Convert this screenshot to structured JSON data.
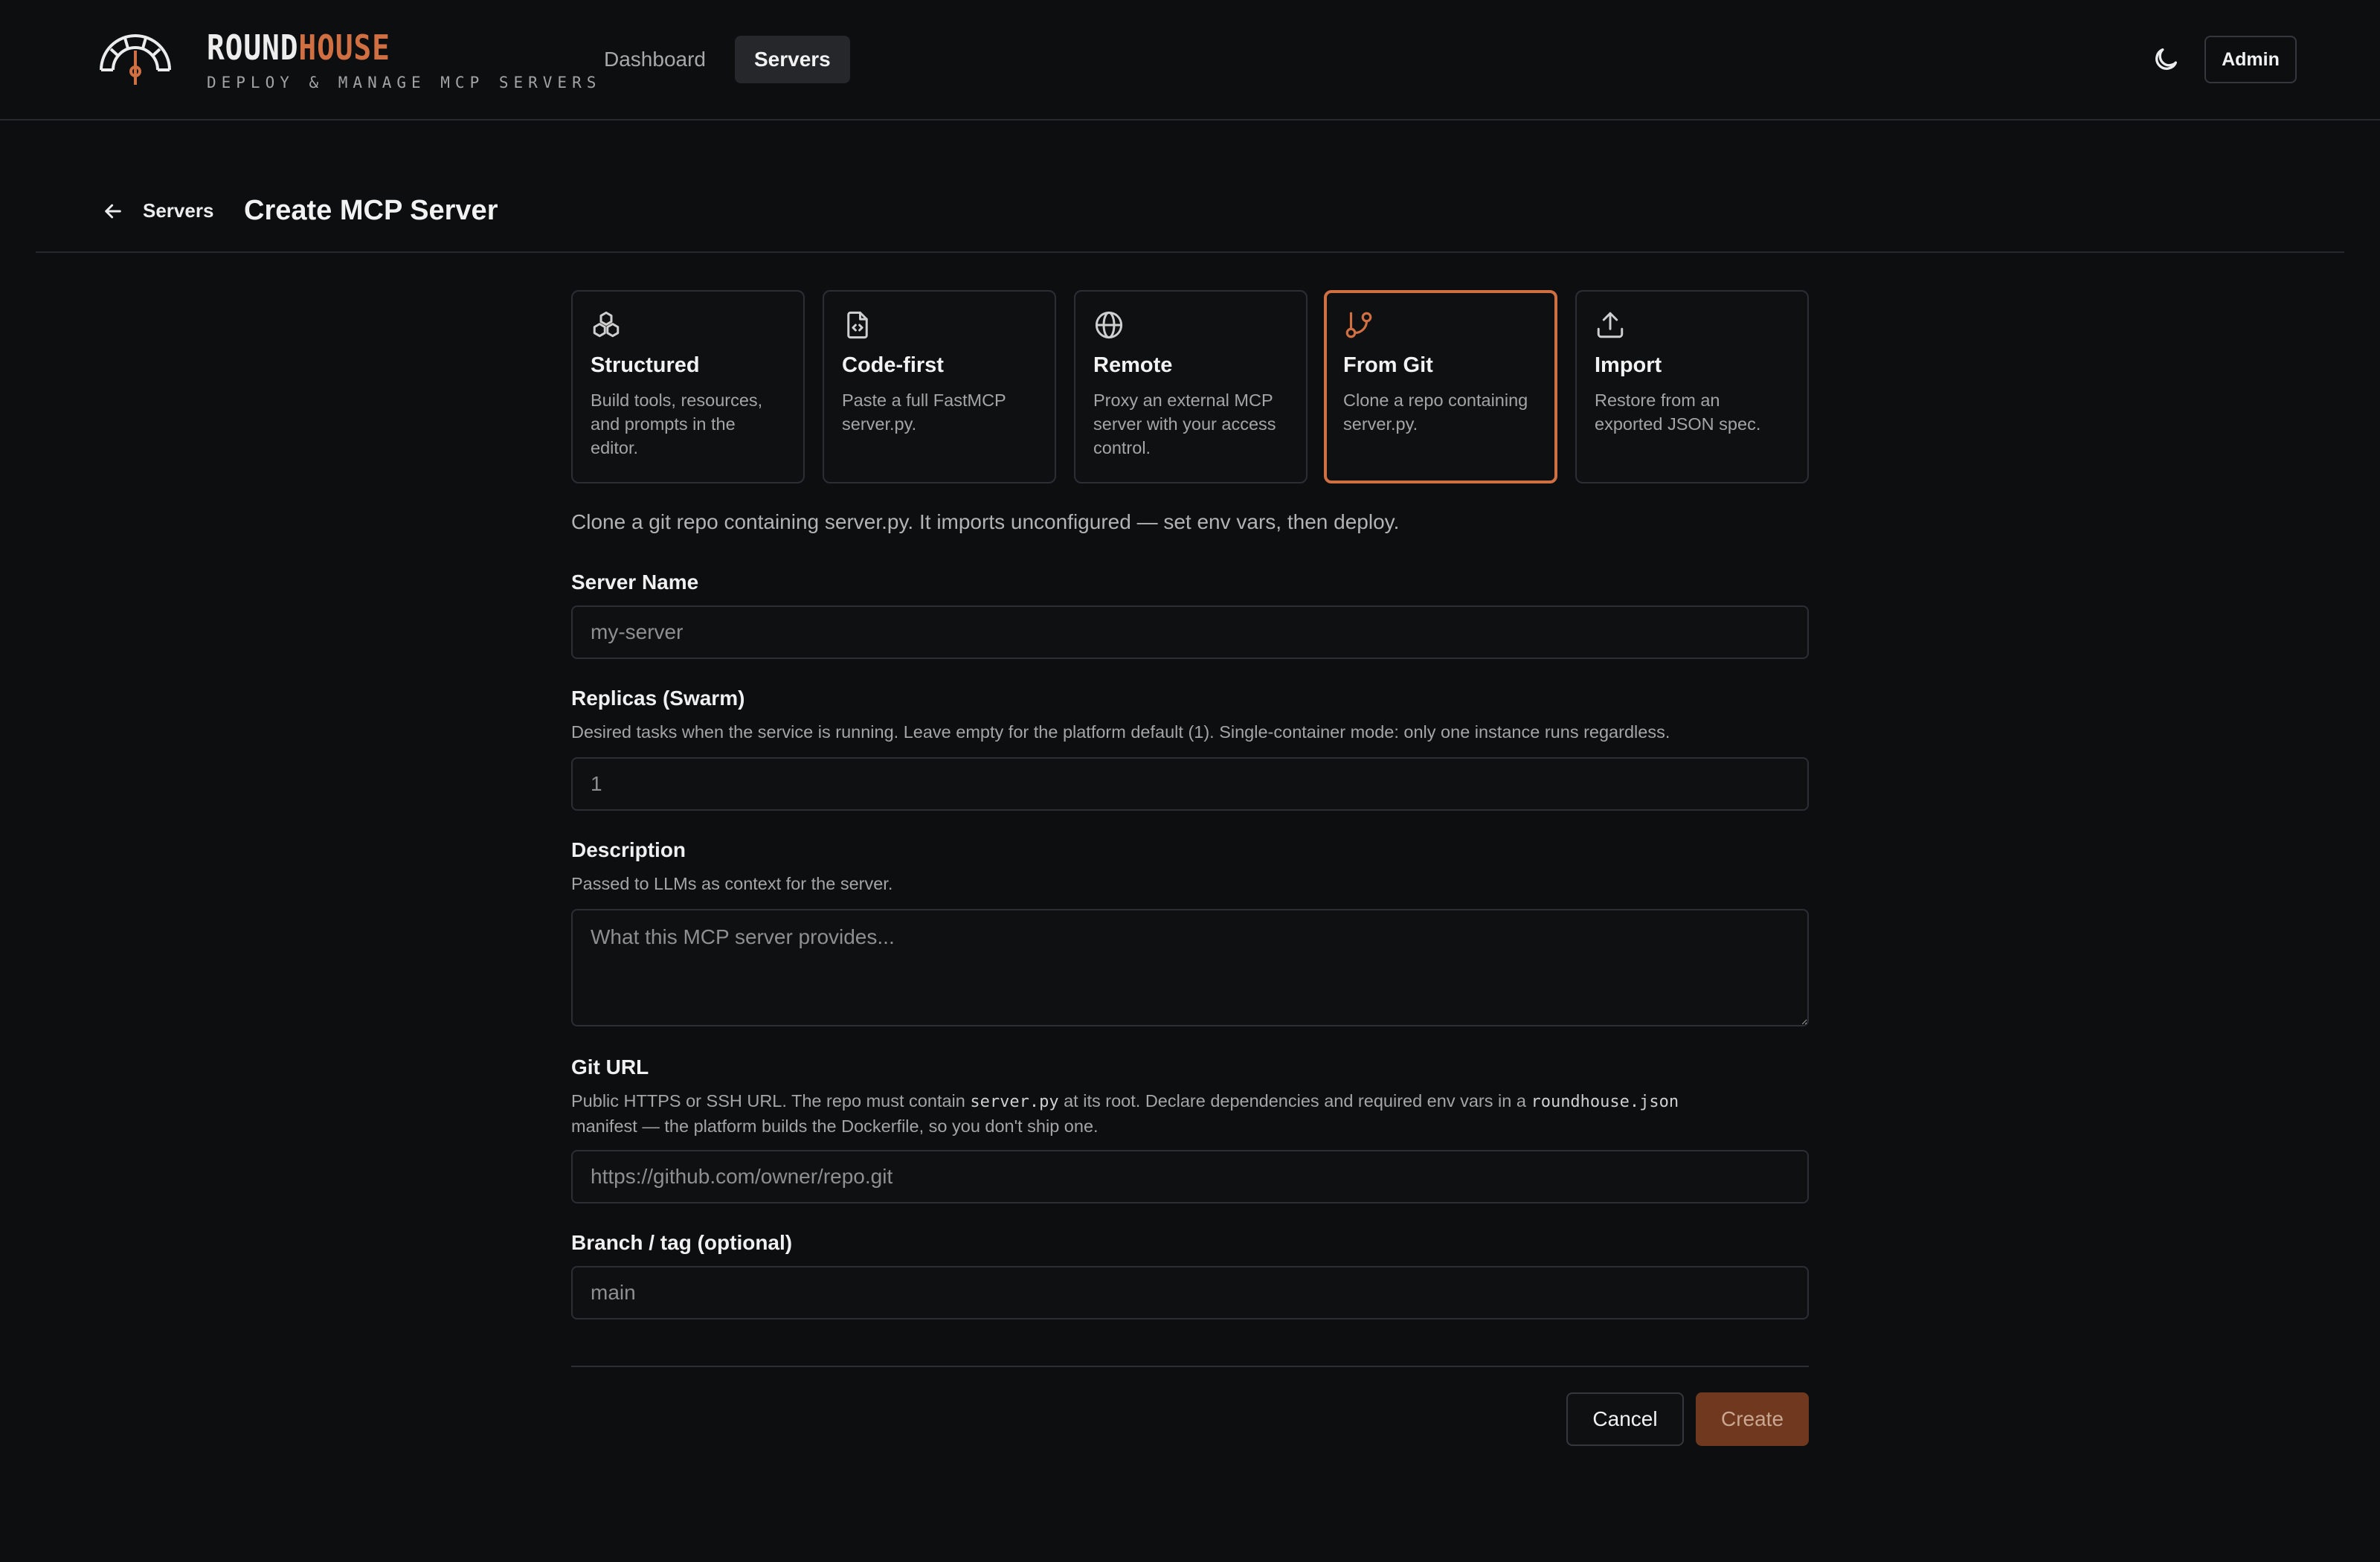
{
  "brand": {
    "name_part1": "ROUND",
    "name_part2": "HOUSE",
    "tagline": "DEPLOY & MANAGE MCP SERVERS"
  },
  "nav": {
    "items": [
      {
        "label": "Dashboard",
        "active": false
      },
      {
        "label": "Servers",
        "active": true
      }
    ]
  },
  "header": {
    "theme_icon": "moon-icon",
    "admin_label": "Admin"
  },
  "breadcrumb": {
    "back_label": "Servers",
    "title": "Create MCP Server"
  },
  "modes": [
    {
      "icon": "boxes-icon",
      "title": "Structured",
      "description": "Build tools, resources, and prompts in the editor.",
      "selected": false
    },
    {
      "icon": "file-code-icon",
      "title": "Code-first",
      "description": "Paste a full FastMCP server.py.",
      "selected": false
    },
    {
      "icon": "globe-icon",
      "title": "Remote",
      "description": "Proxy an external MCP server with your access control.",
      "selected": false
    },
    {
      "icon": "git-branch-icon",
      "title": "From Git",
      "description": "Clone a repo containing server.py.",
      "selected": true
    },
    {
      "icon": "upload-icon",
      "title": "Import",
      "description": "Restore from an exported JSON spec.",
      "selected": false
    }
  ],
  "mode_help": "Clone a git repo containing server.py. It imports unconfigured — set env vars, then deploy.",
  "form": {
    "server_name": {
      "label": "Server Name",
      "placeholder": "my-server",
      "value": ""
    },
    "replicas": {
      "label": "Replicas (Swarm)",
      "hint": "Desired tasks when the service is running. Leave empty for the platform default (1). Single-container mode: only one instance runs regardless.",
      "placeholder": "1",
      "value": ""
    },
    "description": {
      "label": "Description",
      "hint": "Passed to LLMs as context for the server.",
      "placeholder": "What this MCP server provides...",
      "value": ""
    },
    "git_url": {
      "label": "Git URL",
      "hint_part1": "Public HTTPS or SSH URL. The repo must contain ",
      "hint_code1": "server.py",
      "hint_part2": " at its root. Declare dependencies and required env vars in a ",
      "hint_code2": "roundhouse.json",
      "hint_part3": "manifest — the platform builds the Dockerfile, so you don't ship one.",
      "placeholder": "https://github.com/owner/repo.git",
      "value": ""
    },
    "branch": {
      "label": "Branch / tag (optional)",
      "placeholder": "main",
      "value": ""
    }
  },
  "actions": {
    "cancel_label": "Cancel",
    "create_label": "Create"
  },
  "colors": {
    "accent": "#cf6f42",
    "background": "#0d0e10",
    "create_button": "#70391f"
  }
}
